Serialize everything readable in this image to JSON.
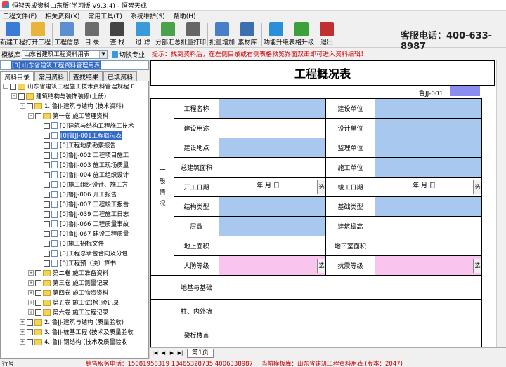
{
  "window": {
    "title": "恒智天成资料山东版(学习版 V9.3.4) - 恒智天成"
  },
  "menu": [
    "工程文件(F)",
    "相关资料(X)",
    "常用工具(T)",
    "系统维护(S)",
    "帮助(H)"
  ],
  "toolbar": [
    {
      "label": "新建工程",
      "icon": "new-project-icon",
      "color": "#3a7bd5"
    },
    {
      "label": "打开工程",
      "icon": "open-folder-icon",
      "color": "#e8b53a"
    },
    {
      "label": "工程信息",
      "icon": "project-info-icon",
      "color": "#5a8fd0"
    },
    {
      "label": "目 录",
      "icon": "catalog-icon",
      "color": "#6c6c6c"
    },
    {
      "label": "查 找",
      "icon": "binoculars-icon",
      "color": "#444"
    },
    {
      "label": "过 滤",
      "icon": "filter-icon",
      "color": "#3a9ad9"
    },
    {
      "label": "分部汇总",
      "icon": "summary-icon",
      "color": "#4aa34a"
    },
    {
      "label": "批量打印",
      "icon": "print-icon",
      "color": "#666"
    },
    {
      "label": "批量增加",
      "icon": "batch-add-icon",
      "color": "#4a7fc8"
    },
    {
      "label": "素材库",
      "icon": "material-library-icon",
      "color": "#3c6fb0"
    },
    {
      "label": "功能升级",
      "icon": "upgrade-icon",
      "color": "#2a8fd8"
    },
    {
      "label": "表格升级",
      "icon": "table-upgrade-icon",
      "color": "#3ca03c"
    },
    {
      "label": "退出",
      "icon": "exit-icon",
      "color": "#c03030"
    }
  ],
  "hotline": "客服电话：400-633-8987",
  "template_bar": {
    "label": "模板库",
    "selected": "山东省建筑工程资料用表",
    "switch_label": "切换专业"
  },
  "hint": "提示：找到资料后，在左侧目录或右侧表格预览界面双击即可进入资料编辑！",
  "current_template": "[0] 山东省建筑工程资料管理用表",
  "left_tabs": [
    "资料目录",
    "常用资料",
    "查找结果",
    "已填资料"
  ],
  "tree": [
    {
      "indent": 0,
      "pm": "-",
      "cb": true,
      "icon": "home",
      "text": "山东省建筑工程施工技术资料管理规程 0"
    },
    {
      "indent": 1,
      "pm": "-",
      "cb": true,
      "icon": "folder",
      "text": "建筑结构与装饰装修(上册)"
    },
    {
      "indent": 2,
      "pm": "-",
      "cb": true,
      "icon": "folder",
      "text": "1. 鲁JJ-建筑与结构 (技术资料)"
    },
    {
      "indent": 3,
      "pm": "-",
      "cb": true,
      "icon": "folder",
      "text": "第一卷 施工管理资料"
    },
    {
      "indent": 4,
      "pm": "",
      "cb": true,
      "icon": "doc",
      "text": "[0]建筑与结构工程施工技术"
    },
    {
      "indent": 4,
      "pm": "",
      "cb": true,
      "icon": "doc",
      "text": "[0]鲁JJ-001工程概况表",
      "selected": true
    },
    {
      "indent": 4,
      "pm": "",
      "cb": true,
      "icon": "doc",
      "text": "[0]工程地质勘察报告"
    },
    {
      "indent": 4,
      "pm": "",
      "cb": true,
      "icon": "doc",
      "text": "[0]鲁JJ-002 工程项目施工"
    },
    {
      "indent": 4,
      "pm": "",
      "cb": true,
      "icon": "doc",
      "text": "[0]鲁JJ-003 施工现场质量"
    },
    {
      "indent": 4,
      "pm": "",
      "cb": true,
      "icon": "doc",
      "text": "[0]鲁JJ-004 施工组织设计"
    },
    {
      "indent": 4,
      "pm": "",
      "cb": true,
      "icon": "doc",
      "text": "[0]施工组织设计、施工方"
    },
    {
      "indent": 4,
      "pm": "",
      "cb": true,
      "icon": "doc",
      "text": "[0]鲁JJ-006 开工报告"
    },
    {
      "indent": 4,
      "pm": "",
      "cb": true,
      "icon": "doc",
      "text": "[0]鲁JJ-007 工程竣工报告"
    },
    {
      "indent": 4,
      "pm": "",
      "cb": true,
      "icon": "doc",
      "text": "[0]鲁JJ-039 工程施工日志"
    },
    {
      "indent": 4,
      "pm": "",
      "cb": true,
      "icon": "doc",
      "text": "[0]鲁JJ-066 工程质量事故"
    },
    {
      "indent": 4,
      "pm": "",
      "cb": true,
      "icon": "doc",
      "text": "[0]鲁JJ-067 建设工程质量"
    },
    {
      "indent": 4,
      "pm": "",
      "cb": true,
      "icon": "doc",
      "text": "[0]施工招标文件"
    },
    {
      "indent": 4,
      "pm": "",
      "cb": true,
      "icon": "doc",
      "text": "[0]工程总承包合同及分包"
    },
    {
      "indent": 4,
      "pm": "",
      "cb": true,
      "icon": "doc",
      "text": "[0]工程预（决）算书"
    },
    {
      "indent": 3,
      "pm": "+",
      "cb": true,
      "icon": "folder",
      "text": "第二卷 施工准备资料"
    },
    {
      "indent": 3,
      "pm": "+",
      "cb": true,
      "icon": "folder",
      "text": "第三卷 施工测量记录"
    },
    {
      "indent": 3,
      "pm": "+",
      "cb": true,
      "icon": "folder",
      "text": "第四卷 施工物资资料"
    },
    {
      "indent": 3,
      "pm": "+",
      "cb": true,
      "icon": "folder",
      "text": "第五卷 施工试(检)验记录"
    },
    {
      "indent": 3,
      "pm": "+",
      "cb": true,
      "icon": "folder",
      "text": "第六卷 施工过程记录"
    },
    {
      "indent": 2,
      "pm": "+",
      "cb": true,
      "icon": "folder",
      "text": "2. 鲁JJ-建筑与结构 (质量验收)"
    },
    {
      "indent": 2,
      "pm": "+",
      "cb": true,
      "icon": "folder",
      "text": "3. 鲁JJ-桩基工程 (技术及质量验收"
    },
    {
      "indent": 2,
      "pm": "+",
      "cb": true,
      "icon": "folder",
      "text": "4. 鲁JJ-钢结构 (技术及质量验收"
    }
  ],
  "sheet": {
    "title": "工程概况表",
    "code": "鲁JJ-001",
    "section_label": "一\n般\n情\n况",
    "rows": [
      {
        "l": "工程名称",
        "lc": "blue",
        "r": "建设单位",
        "rc": "blue"
      },
      {
        "l": "建设用途",
        "lc": "white",
        "r": "设计单位",
        "rc": "blue"
      },
      {
        "l": "建设地点",
        "lc": "blue",
        "r": "监理单位",
        "rc": "blue"
      },
      {
        "l": "总建筑面积",
        "lc": "white",
        "r": "施工单位",
        "rc": "blue"
      },
      {
        "l": "开工日期",
        "lc": "date",
        "r": "竣工日期",
        "rc": "date"
      },
      {
        "l": "结构类型",
        "lc": "blue",
        "r": "基础类型",
        "rc": "blue"
      },
      {
        "l": "层数",
        "lc": "blue",
        "r": "建筑檐高",
        "rc": "white"
      },
      {
        "l": "地上面积",
        "lc": "white",
        "r": "地下室面积",
        "rc": "white"
      },
      {
        "l": "人防等级",
        "lc": "pink",
        "r": "抗震等级",
        "rc": "pink"
      }
    ],
    "date_text": "年   月   日",
    "select_label": "选",
    "bottom_rows": [
      "地基与基础",
      "柱、内外墙",
      "梁板楼盖"
    ]
  },
  "sheet_tab": "第1页",
  "status": {
    "pos": "行号:",
    "sales": "销售服务电话：15081958319 13465328735 4006338987",
    "current": "当前模板库：山东省建筑工程资料用表  (版本：2047)"
  }
}
